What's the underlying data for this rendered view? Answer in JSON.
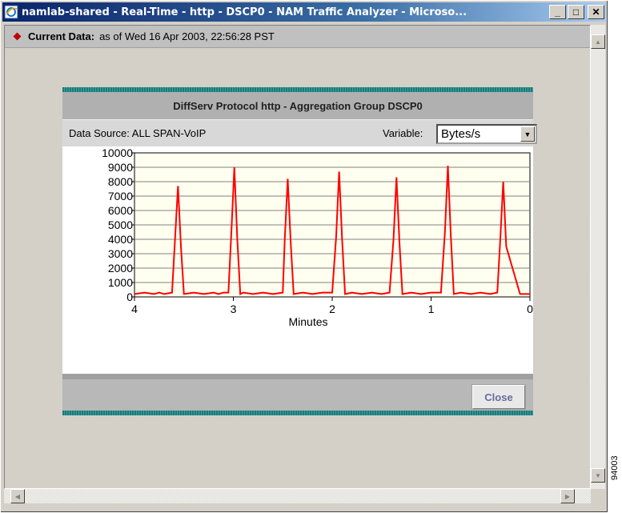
{
  "window": {
    "title": "namlab-shared - Real-Time - http - DSCP0 - NAM Traffic Analyzer - Microso...",
    "minimize_label": "_",
    "maximize_label": "□",
    "close_label": "✕"
  },
  "current_data": {
    "label": "Current Data:",
    "value": "as of Wed 16 Apr 2003, 22:56:28 PST"
  },
  "panel": {
    "title": "DiffServ Protocol http - Aggregation Group DSCP0",
    "data_source": "Data Source: ALL SPAN-VoIP",
    "variable_label": "Variable:",
    "variable_value": "Bytes/s",
    "close_label": "Close"
  },
  "side_id": "94003",
  "colors": {
    "line": "#ff0000",
    "plot_bg": "#fffff0",
    "stripe": "#1d7a7a"
  },
  "chart_data": {
    "type": "line",
    "xlabel": "Minutes",
    "ylabel": "",
    "xlim": [
      4,
      0
    ],
    "ylim": [
      0,
      10000
    ],
    "x_ticks": [
      "4",
      "3",
      "2",
      "1",
      "0"
    ],
    "y_ticks": [
      "0",
      "1000",
      "2000",
      "3000",
      "4000",
      "5000",
      "6000",
      "7000",
      "8000",
      "9000",
      "10000"
    ],
    "grid": true,
    "series": [
      {
        "x": [
          4.0,
          3.9,
          3.8,
          3.75,
          3.7,
          3.62,
          3.59,
          3.56,
          3.53,
          3.5,
          3.4,
          3.3,
          3.2,
          3.15,
          3.1,
          3.05,
          3.02,
          2.99,
          2.96,
          2.93,
          2.9,
          2.8,
          2.7,
          2.6,
          2.5,
          2.48,
          2.45,
          2.42,
          2.39,
          2.3,
          2.2,
          2.1,
          2.0,
          1.96,
          1.93,
          1.9,
          1.87,
          1.8,
          1.7,
          1.6,
          1.5,
          1.42,
          1.38,
          1.35,
          1.32,
          1.29,
          1.2,
          1.1,
          1.0,
          0.9,
          0.86,
          0.83,
          0.8,
          0.77,
          0.7,
          0.6,
          0.5,
          0.4,
          0.33,
          0.3,
          0.27,
          0.24,
          0.1,
          0.0
        ],
        "y": [
          200,
          300,
          200,
          300,
          200,
          300,
          4000,
          7700,
          3500,
          200,
          300,
          200,
          300,
          200,
          300,
          300,
          4500,
          9000,
          4000,
          200,
          300,
          200,
          300,
          200,
          300,
          4000,
          8200,
          3800,
          200,
          300,
          200,
          300,
          300,
          4200,
          8700,
          4000,
          200,
          300,
          200,
          300,
          200,
          300,
          4000,
          8300,
          3800,
          200,
          300,
          200,
          300,
          300,
          4500,
          9100,
          4200,
          200,
          300,
          200,
          300,
          200,
          300,
          4000,
          8000,
          3500,
          200,
          200
        ]
      }
    ]
  }
}
